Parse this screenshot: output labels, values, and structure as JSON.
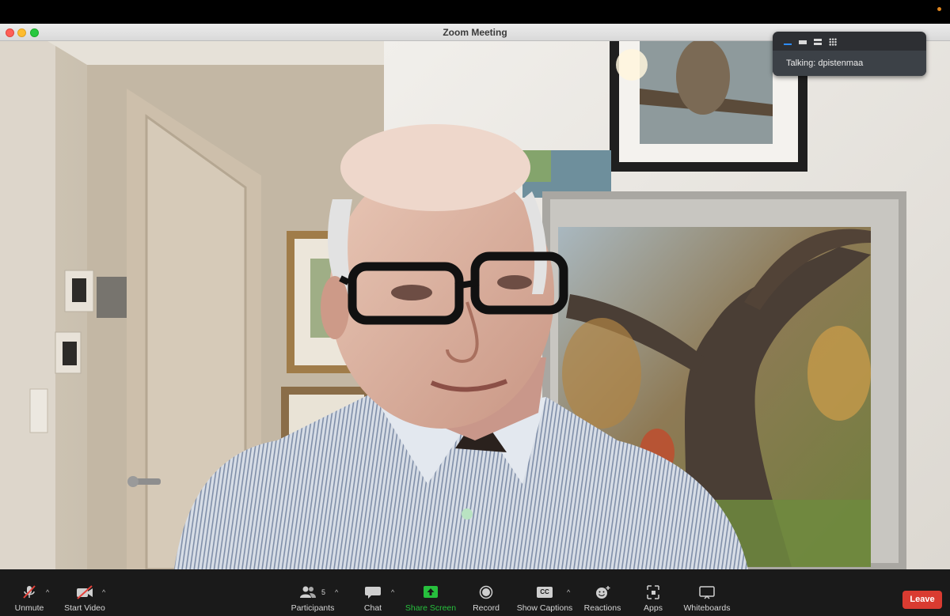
{
  "window": {
    "title": "Zoom Meeting"
  },
  "speaker_panel": {
    "talking_text": "Talking: dpistenmaa",
    "view_icons": [
      "speaker-view-icon",
      "filmstrip-view-icon",
      "stacked-view-icon",
      "gallery-view-icon"
    ]
  },
  "toolbar": {
    "unmute": "Unmute",
    "start_video": "Start Video",
    "participants": "Participants",
    "participants_count": "5",
    "chat": "Chat",
    "share_screen": "Share Screen",
    "record": "Record",
    "show_captions": "Show Captions",
    "captions_badge": "CC",
    "reactions": "Reactions",
    "apps": "Apps",
    "whiteboards": "Whiteboards",
    "leave": "Leave"
  },
  "colors": {
    "leave": "#d93b31",
    "share_screen": "#27c03d",
    "toolbar_bg": "#1a1a1a",
    "accent": "#2d8cff"
  }
}
